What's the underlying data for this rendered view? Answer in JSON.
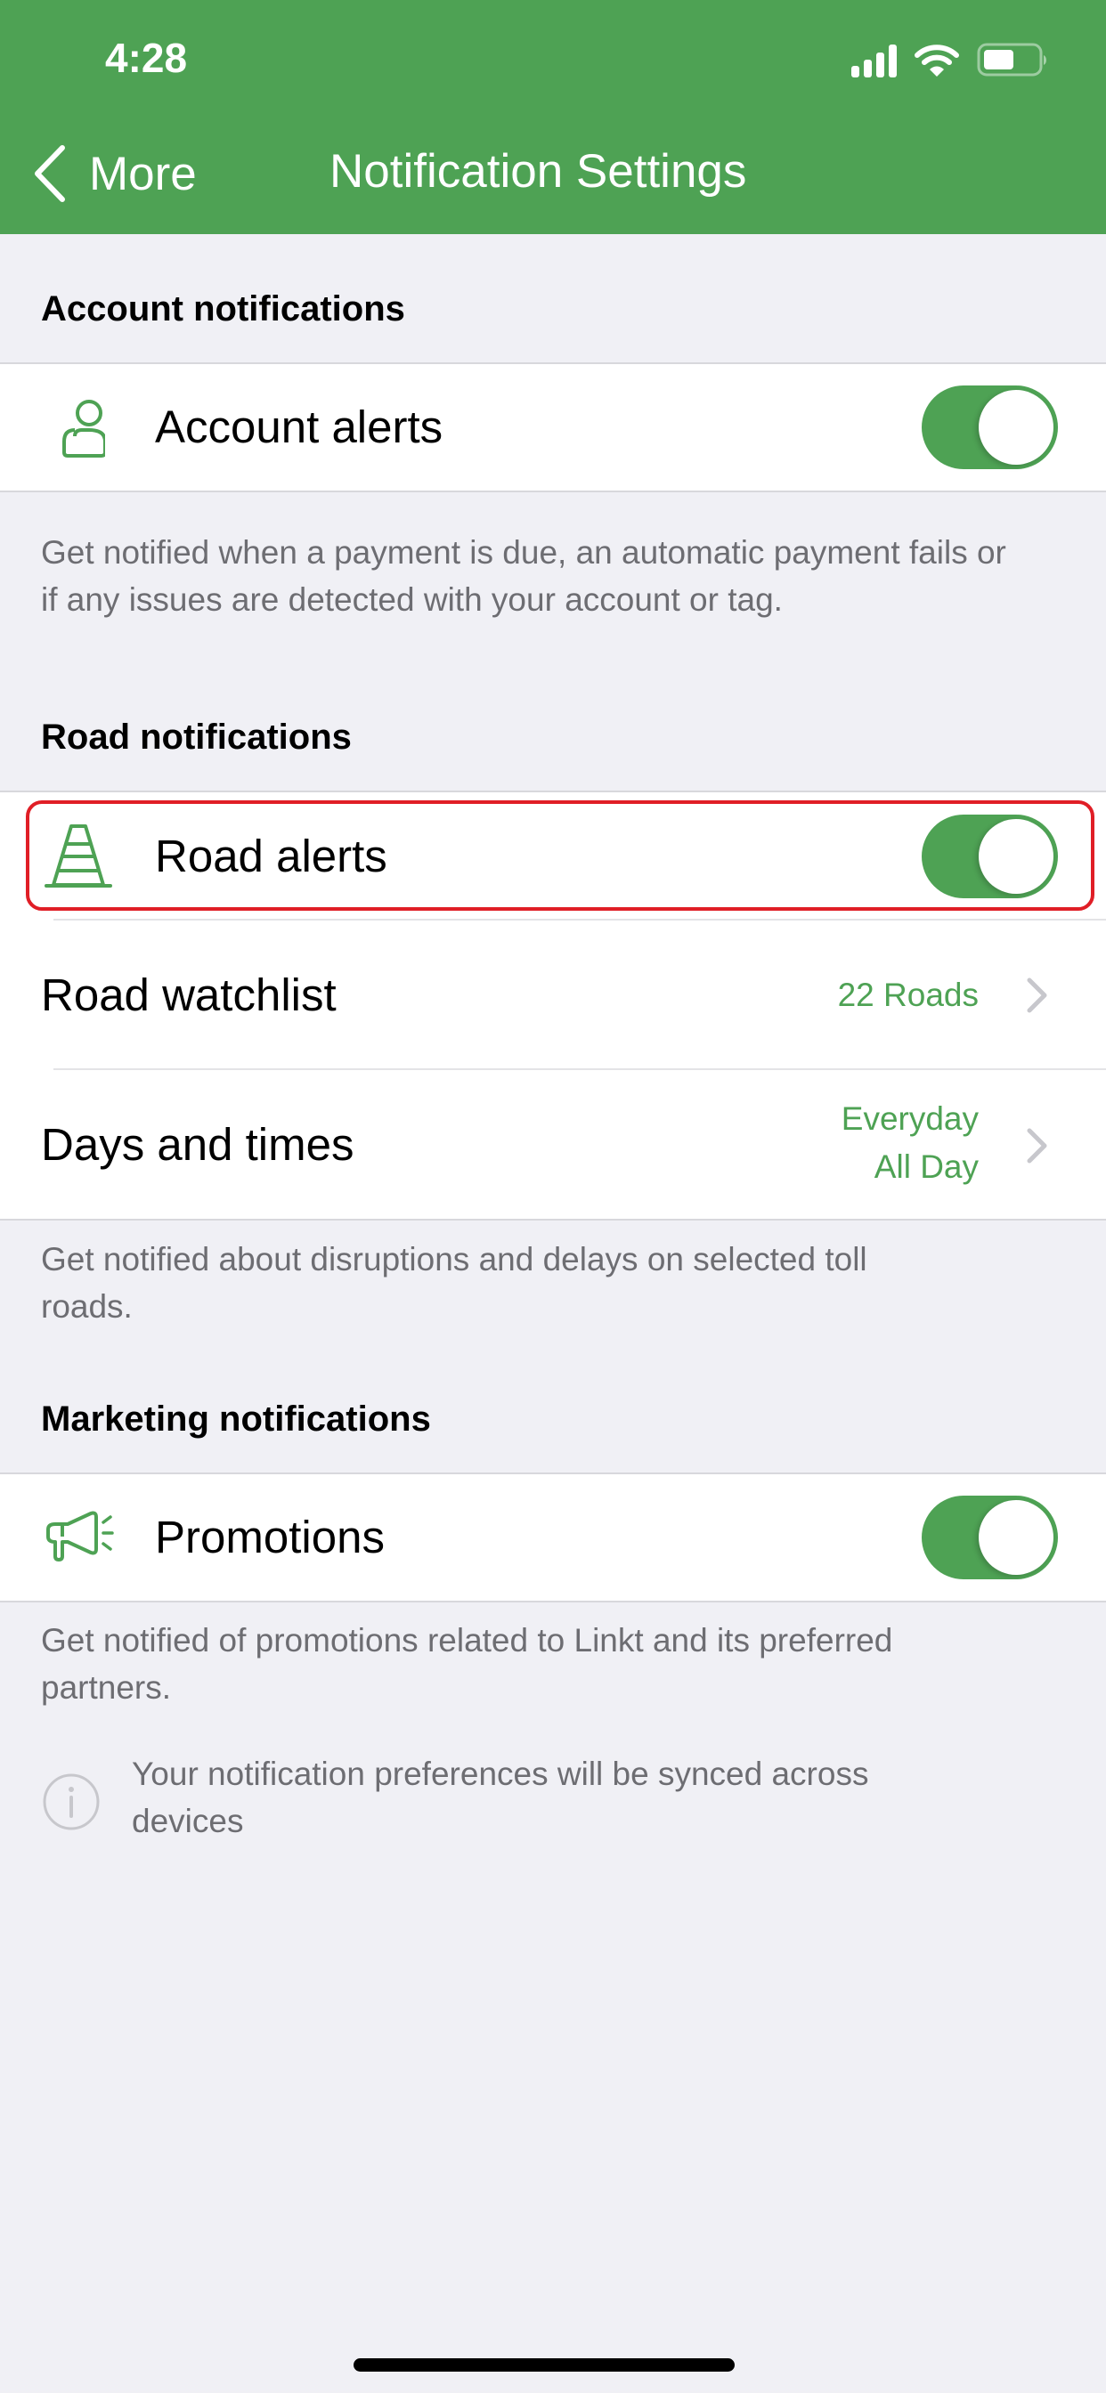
{
  "status_bar": {
    "time": "4:28",
    "signal_icon": "cellular-signal-icon",
    "wifi_icon": "wifi-icon",
    "battery_icon": "battery-icon",
    "battery_level": 0.5
  },
  "nav": {
    "back_icon": "chevron-left-icon",
    "back_label": "More",
    "title": "Notification Settings"
  },
  "colors": {
    "brand": "#4EA254",
    "highlight": "#E01E26",
    "background": "#F0F0F5",
    "secondary_text": "#6D6D72"
  },
  "sections": {
    "account": {
      "heading": "Account notifications",
      "rows": [
        {
          "icon": "person-icon",
          "label": "Account alerts",
          "toggle_on": true
        }
      ],
      "description": "Get notified when a payment is due, an automatic payment fails or if any issues are detected with your account or tag."
    },
    "road": {
      "heading": "Road notifications",
      "rows": [
        {
          "icon": "traffic-cone-icon",
          "label": "Road alerts",
          "toggle_on": true,
          "highlighted": true
        },
        {
          "label": "Road watchlist",
          "value": "22 Roads",
          "chevron": "chevron-right-icon"
        },
        {
          "label": "Days and times",
          "value_line1": "Everyday",
          "value_line2": "All Day",
          "chevron": "chevron-right-icon"
        }
      ],
      "description": "Get notified about disruptions and delays on selected toll roads."
    },
    "marketing": {
      "heading": "Marketing notifications",
      "rows": [
        {
          "icon": "megaphone-icon",
          "label": "Promotions",
          "toggle_on": true
        }
      ],
      "description": "Get notified of promotions related to Linkt and its preferred partners."
    }
  },
  "info": {
    "icon": "info-icon",
    "text": "Your notification preferences will be synced across devices"
  }
}
